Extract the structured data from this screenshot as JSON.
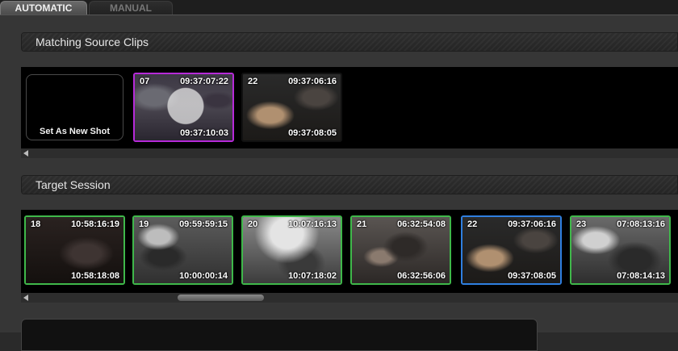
{
  "tabs": [
    {
      "label": "AUTOMATIC",
      "active": true
    },
    {
      "label": "MANUAL",
      "active": false
    }
  ],
  "matching": {
    "title": "Matching Source Clips",
    "new_shot_label": "Set As New Shot",
    "clips": [
      {
        "num": "07",
        "tc_in": "09:37:07:22",
        "tc_out": "09:37:10:03",
        "border": "magenta"
      },
      {
        "num": "22",
        "tc_in": "09:37:06:16",
        "tc_out": "09:37:08:05",
        "border": "none"
      }
    ]
  },
  "target": {
    "title": "Target Session",
    "clips": [
      {
        "num": "18",
        "tc_in": "10:58:16:19",
        "tc_out": "10:58:18:08",
        "border": "green"
      },
      {
        "num": "19",
        "tc_in": "09:59:59:15",
        "tc_out": "10:00:00:14",
        "border": "green"
      },
      {
        "num": "20",
        "tc_in": "10:07:16:13",
        "tc_out": "10:07:18:02",
        "border": "green"
      },
      {
        "num": "21",
        "tc_in": "06:32:54:08",
        "tc_out": "06:32:56:06",
        "border": "green"
      },
      {
        "num": "22",
        "tc_in": "09:37:06:16",
        "tc_out": "09:37:08:05",
        "border": "blue"
      },
      {
        "num": "23",
        "tc_in": "07:08:13:16",
        "tc_out": "07:08:14:13",
        "border": "green"
      }
    ]
  },
  "colors": {
    "selected_border": "#b62ad8",
    "matched_border": "#3fb84a",
    "current_border": "#2f7fe0"
  }
}
